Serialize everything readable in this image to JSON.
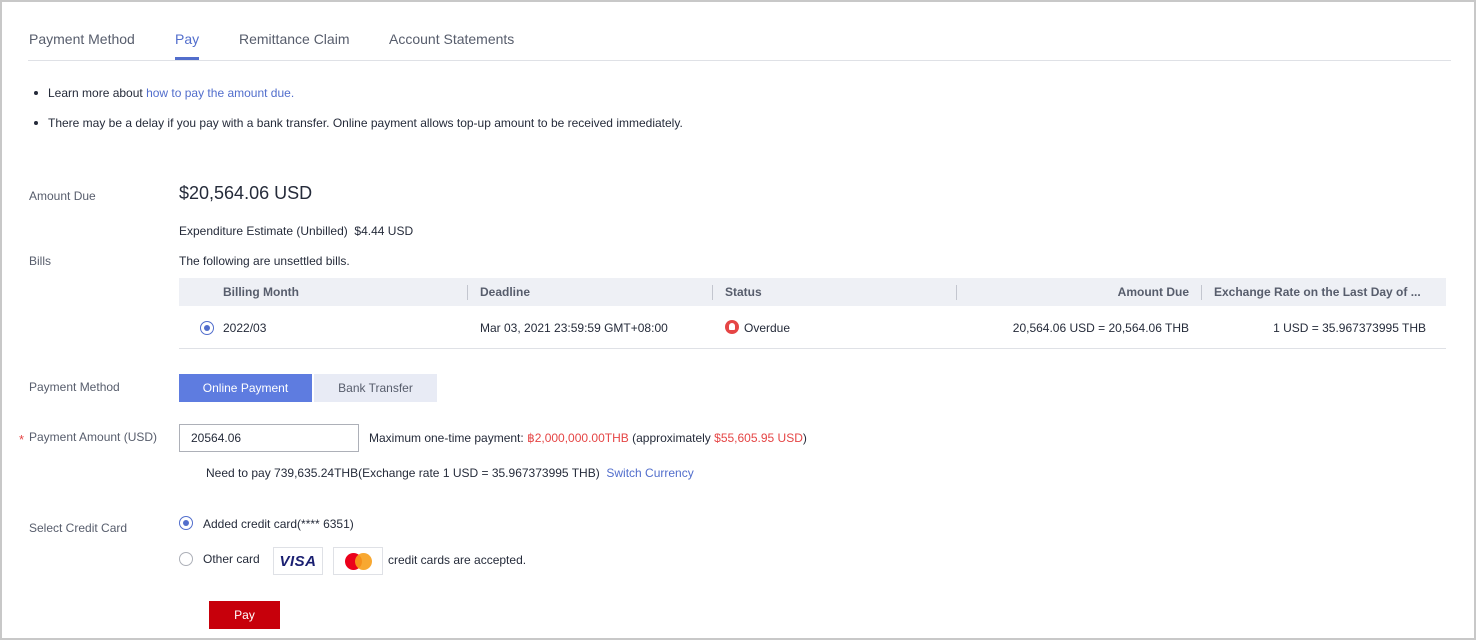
{
  "tabs": [
    {
      "label": "Payment Method"
    },
    {
      "label": "Pay"
    },
    {
      "label": "Remittance Claim"
    },
    {
      "label": "Account Statements"
    }
  ],
  "tips": {
    "learn_prefix": "Learn more about ",
    "learn_link": "how to pay the amount due.",
    "delay": "There may be a delay if you pay with a bank transfer. Online payment allows top-up amount to be received immediately."
  },
  "amount_due": {
    "label": "Amount Due",
    "value": "$20,564.06 USD",
    "estimate_label": "Expenditure Estimate (Unbilled)",
    "estimate_value": "$4.44 USD"
  },
  "bills": {
    "label": "Bills",
    "note": "The following are unsettled bills.",
    "columns": [
      "Billing Month",
      "Deadline",
      "Status",
      "Amount Due",
      "Exchange Rate on the Last Day of ..."
    ],
    "rows": [
      {
        "month": "2022/03",
        "deadline": "Mar 03, 2021 23:59:59 GMT+08:00",
        "status": "Overdue",
        "amount": "20,564.06 USD = 20,564.06 THB",
        "rate": "1 USD = 35.967373995 THB"
      }
    ]
  },
  "payment_method": {
    "label": "Payment Method",
    "online": "Online Payment",
    "bank": "Bank Transfer",
    "active_color": "#5e7ce0"
  },
  "payment_amount": {
    "required_mark": "*",
    "label": "Payment Amount (USD)",
    "value": "20564.06",
    "max_prefix": "Maximum one-time payment: ",
    "max_thb": "฿2,000,000.00THB",
    "approx_prefix": " (approximately ",
    "approx_usd": "$55,605.95 USD",
    "approx_suffix": ")",
    "need_pay": "Need to pay 739,635.24THB(Exchange rate 1 USD = 35.967373995 THB)",
    "switch_currency": "Switch Currency"
  },
  "credit_card": {
    "label": "Select Credit Card",
    "added": "Added credit card(**** 6351)",
    "other": "Other card",
    "visa": "VISA",
    "accepted": "credit cards are accepted."
  },
  "pay_button": {
    "label": "Pay",
    "color": "#c7000b"
  }
}
